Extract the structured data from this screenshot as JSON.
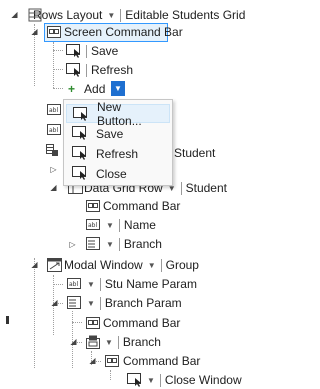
{
  "tree": {
    "root": {
      "label": "Rows Layout",
      "dropdown": "Editable Students Grid"
    },
    "screen_command_bar": {
      "label": "Screen Command Bar"
    },
    "save": "Save",
    "refresh": "Refresh",
    "add": {
      "label": "Add"
    },
    "student_label": "Student",
    "data_grid_row": {
      "label": "Data Grid Row",
      "dropdown": "Student"
    },
    "command_bar_1": "Command Bar",
    "name": "Name",
    "branch_1": "Branch",
    "modal_window": {
      "label": "Modal Window",
      "dropdown": "Group"
    },
    "stu_name_param": "Stu Name Param",
    "branch_param": "Branch Param",
    "command_bar_2": "Command Bar",
    "branch_2": "Branch",
    "command_bar_3": "Command Bar",
    "close_window": "Close Window"
  },
  "context_menu": {
    "items": [
      "New Button...",
      "Save",
      "Refresh",
      "Close"
    ]
  },
  "colors": {
    "selection_border": "#3399ff",
    "selection_fill": "#e5f1fb",
    "dropdown_button": "#1e6fd0",
    "add_plus": "#2e8b2e"
  }
}
